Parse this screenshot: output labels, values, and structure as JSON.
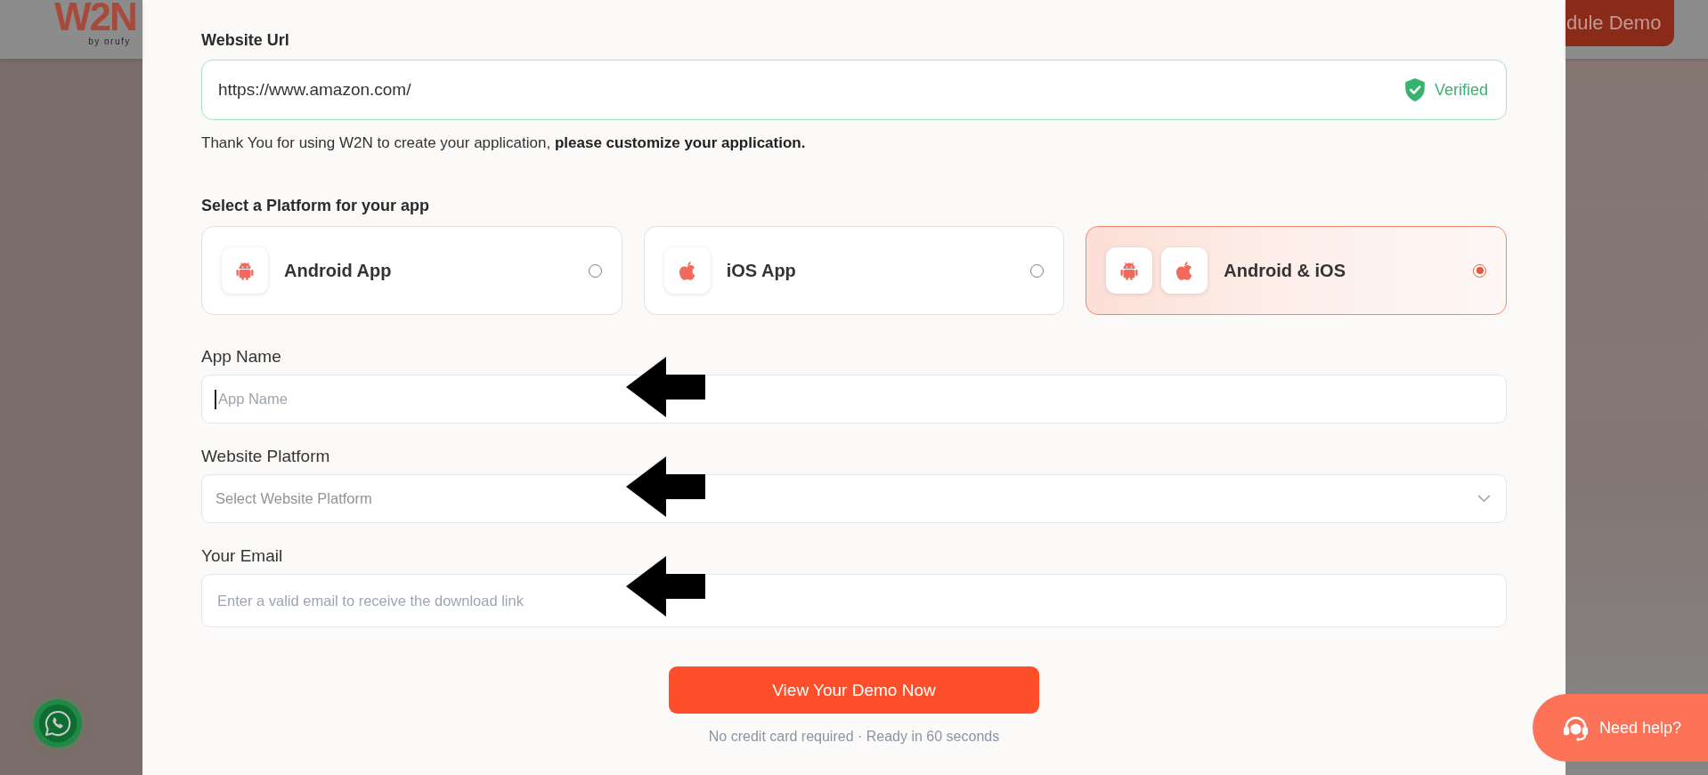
{
  "header": {
    "logo": {
      "text": "W2N",
      "tagline": "by orufy"
    },
    "cta_button": {
      "label": "dule Demo"
    }
  },
  "form": {
    "url_field": {
      "label": "Website Url",
      "value": "https://www.amazon.com/",
      "verified": true,
      "status": "Verified"
    },
    "notice": "Thank You for using W2N to create your application, **please customize your application.**",
    "platform_section": {
      "title": "Select a Platform for your app",
      "options": [
        {
          "kind": "android",
          "label": "Android App",
          "selected": false
        },
        {
          "kind": "ios",
          "label": "iOS App",
          "selected": false
        },
        {
          "kind": "android_ios",
          "label": "Android & iOS",
          "selected": true
        }
      ]
    },
    "fields": [
      {
        "kind": "text",
        "label": "App Name",
        "placeholder": "App Name",
        "focused": true
      },
      {
        "kind": "select",
        "label": "Website Platform",
        "placeholder": "Select Website Platform",
        "focused": false
      },
      {
        "kind": "email",
        "label": "Your Email",
        "placeholder": "Enter a valid email to receive the download link",
        "focused": false
      }
    ],
    "submit_button": {
      "label": "View Your Demo Now"
    },
    "footnote": "No credit card required · Ready in 60 seconds"
  },
  "help_button": {
    "label": "Need help?"
  }
}
